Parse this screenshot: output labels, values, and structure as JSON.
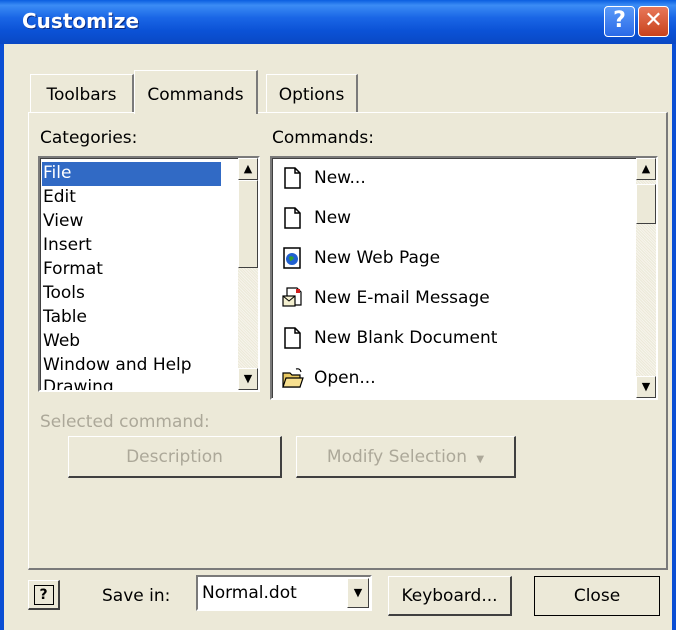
{
  "window": {
    "title": "Customize"
  },
  "tabs": [
    {
      "label": "Toolbars",
      "active": false
    },
    {
      "label": "Commands",
      "active": true
    },
    {
      "label": "Options",
      "active": false
    }
  ],
  "categories": {
    "label": "Categories:",
    "items": [
      "File",
      "Edit",
      "View",
      "Insert",
      "Format",
      "Tools",
      "Table",
      "Web",
      "Window and Help",
      "Drawing"
    ],
    "selected": "File"
  },
  "commands": {
    "label": "Commands:",
    "items": [
      {
        "label": "New...",
        "icon": "new-document-icon"
      },
      {
        "label": "New",
        "icon": "new-document-icon"
      },
      {
        "label": "New Web Page",
        "icon": "web-page-icon"
      },
      {
        "label": "New E-mail Message",
        "icon": "email-message-icon"
      },
      {
        "label": "New Blank Document",
        "icon": "blank-document-icon"
      },
      {
        "label": "Open...",
        "icon": "open-folder-icon"
      }
    ]
  },
  "selected_command": {
    "label": "Selected command:",
    "description_button": "Description",
    "modify_button": "Modify Selection",
    "modify_arrow": "▼"
  },
  "footer": {
    "save_in_label": "Save in:",
    "save_in_value": "Normal.dot",
    "keyboard_button": "Keyboard...",
    "close_button": "Close",
    "help_icon_text": "?"
  },
  "colors": {
    "selection": "#316ac5",
    "titlebar": "#0a5ee0",
    "disabled_text": "#aca899"
  }
}
